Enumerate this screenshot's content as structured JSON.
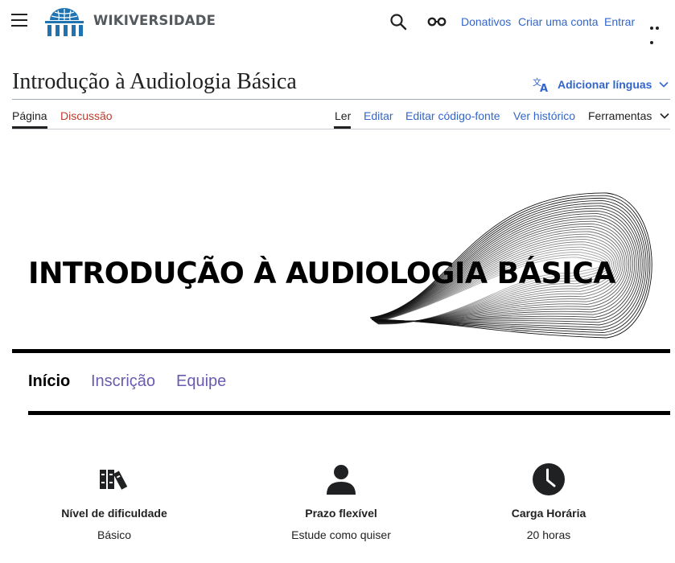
{
  "header": {
    "wordmark": "WIKIVERSIDADE",
    "links": {
      "donate": "Donativos",
      "create_account": "Criar uma conta",
      "login": "Entrar"
    }
  },
  "page": {
    "title": "Introdução à Audiologia Básica",
    "add_languages": "Adicionar línguas"
  },
  "tabs": {
    "page": "Página",
    "discussion": "Discussão",
    "read": "Ler",
    "edit": "Editar",
    "edit_source": "Editar código-fonte",
    "history": "Ver histórico",
    "tools": "Ferramentas"
  },
  "banner": {
    "title": "INTRODUÇÃO À AUDIOLOGIA BÁSICA"
  },
  "course_nav": {
    "start": "Início",
    "enroll": "Inscrição",
    "team": "Equipe"
  },
  "info": [
    {
      "icon": "books-icon",
      "title": "Nível de dificuldade",
      "value": "Básico"
    },
    {
      "icon": "person-icon",
      "title": "Prazo flexível",
      "value": "Estude como quiser"
    },
    {
      "icon": "clock-icon",
      "title": "Carga Horária",
      "value": "20 horas"
    }
  ],
  "colors": {
    "link": "#3366cc",
    "new_link": "#bf3c2c",
    "course_nav_link": "#6b5bb0",
    "logo": "#1e73b0"
  }
}
